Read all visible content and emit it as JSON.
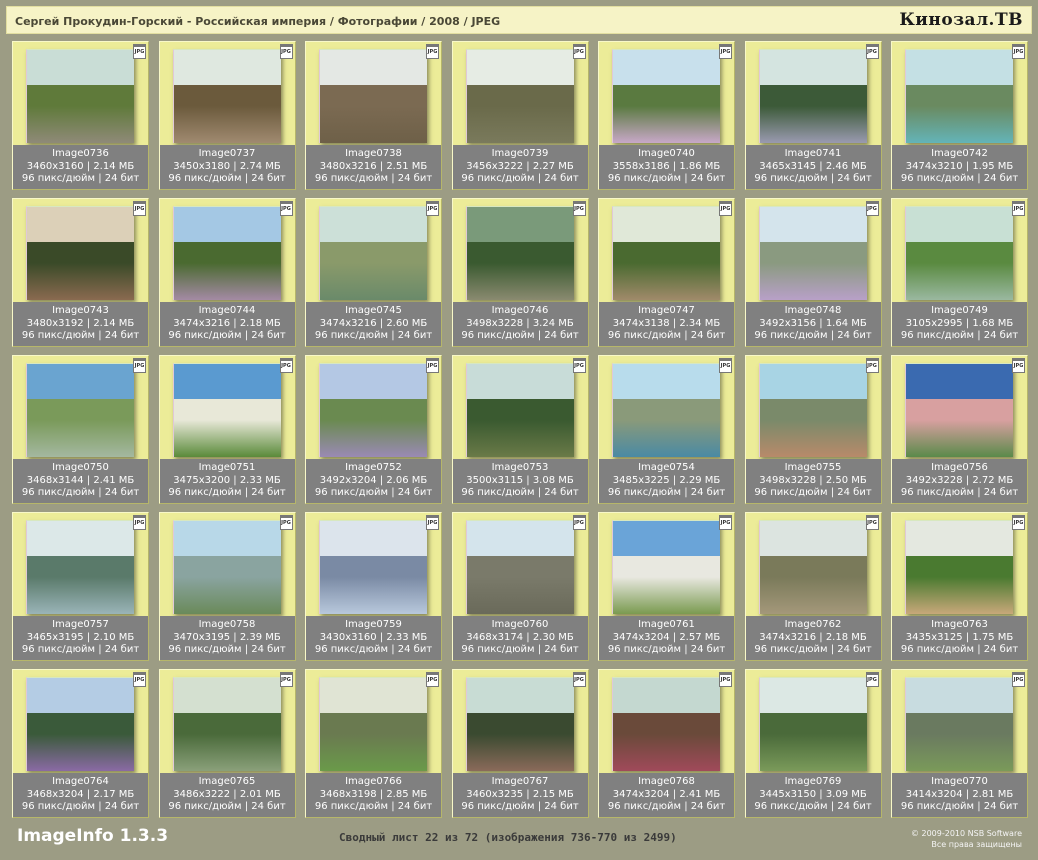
{
  "header": {
    "path": "Сергей Прокудин-Горский - Российская империя / Фотографии / 2008 / JPEG",
    "logo": "Кинозал.ТВ"
  },
  "badge": "JPG",
  "colors": {
    "background": "#9c9c84",
    "card": "#ecec98",
    "info_bar": "#808080",
    "header": "#f6f3c6"
  },
  "images": [
    {
      "name": "Image0736",
      "dims": "3460x3160",
      "size": "2.14 МБ",
      "meta": "96 пикс/дюйм | 24 бит",
      "pal": [
        "#c9ddd6",
        "#5f7a3a",
        "#8f8a78"
      ]
    },
    {
      "name": "Image0737",
      "dims": "3450x3180",
      "size": "2.74 МБ",
      "meta": "96 пикс/дюйм | 24 бит",
      "pal": [
        "#dfe8e0",
        "#6b5a3c",
        "#a08a70"
      ]
    },
    {
      "name": "Image0738",
      "dims": "3480x3216",
      "size": "2.51 МБ",
      "meta": "96 пикс/дюйм | 24 бит",
      "pal": [
        "#e4e8e4",
        "#7b6a52",
        "#6e6048"
      ]
    },
    {
      "name": "Image0739",
      "dims": "3456x3222",
      "size": "2.27 МБ",
      "meta": "96 пикс/дюйм | 24 бит",
      "pal": [
        "#e6ece4",
        "#6a6a4a",
        "#7a7a5c"
      ]
    },
    {
      "name": "Image0740",
      "dims": "3558x3186",
      "size": "1.86 МБ",
      "meta": "96 пикс/дюйм | 24 бит",
      "pal": [
        "#c8e0ec",
        "#5a7a40",
        "#c8a8c8"
      ]
    },
    {
      "name": "Image0741",
      "dims": "3465x3145",
      "size": "2.46 МБ",
      "meta": "96 пикс/дюйм | 24 бит",
      "pal": [
        "#d4e4e0",
        "#3c5a38",
        "#9a9ab0"
      ]
    },
    {
      "name": "Image0742",
      "dims": "3474x3210",
      "size": "1.95 МБ",
      "meta": "96 пикс/дюйм | 24 бит",
      "pal": [
        "#c4e0e4",
        "#6a8a60",
        "#64b4b8"
      ]
    },
    {
      "name": "Image0743",
      "dims": "3480x3192",
      "size": "2.14 МБ",
      "meta": "96 пикс/дюйм | 24 бит",
      "pal": [
        "#dcd0b8",
        "#3a4a28",
        "#8a6a50"
      ]
    },
    {
      "name": "Image0744",
      "dims": "3474x3216",
      "size": "2.18 МБ",
      "meta": "96 пикс/дюйм | 24 бит",
      "pal": [
        "#a4c8e4",
        "#4a6a30",
        "#a48aa4"
      ]
    },
    {
      "name": "Image0745",
      "dims": "3474x3216",
      "size": "2.60 МБ",
      "meta": "96 пикс/дюйм | 24 бит",
      "pal": [
        "#cce0d8",
        "#8a9a6a",
        "#6a8a6a"
      ]
    },
    {
      "name": "Image0746",
      "dims": "3498x3228",
      "size": "3.24 МБ",
      "meta": "96 пикс/дюйм | 24 бит",
      "pal": [
        "#7a9a7a",
        "#3a5a30",
        "#8a8a70"
      ]
    },
    {
      "name": "Image0747",
      "dims": "3474x3138",
      "size": "2.34 МБ",
      "meta": "96 пикс/дюйм | 24 бит",
      "pal": [
        "#e0e8d8",
        "#4a6a30",
        "#a08a6a"
      ]
    },
    {
      "name": "Image0748",
      "dims": "3492x3156",
      "size": "1.64 МБ",
      "meta": "96 пикс/дюйм | 24 бит",
      "pal": [
        "#d4e4ec",
        "#8a9a80",
        "#b8a0c8"
      ]
    },
    {
      "name": "Image0749",
      "dims": "3105x2995",
      "size": "1.68 МБ",
      "meta": "96 пикс/дюйм | 24 бит",
      "pal": [
        "#c8e0d4",
        "#5a8a40",
        "#9ab8a0"
      ]
    },
    {
      "name": "Image0750",
      "dims": "3468x3144",
      "size": "2.41 МБ",
      "meta": "96 пикс/дюйм | 24 бит",
      "pal": [
        "#6aa4d0",
        "#7a9a5a",
        "#a4b8a0"
      ]
    },
    {
      "name": "Image0751",
      "dims": "3475x3200",
      "size": "2.33 МБ",
      "meta": "96 пикс/дюйм | 24 бит",
      "pal": [
        "#5a9ad0",
        "#e8e8d8",
        "#5a8a3a"
      ]
    },
    {
      "name": "Image0752",
      "dims": "3492x3204",
      "size": "2.06 МБ",
      "meta": "96 пикс/дюйм | 24 бит",
      "pal": [
        "#b4c8e4",
        "#6a8a50",
        "#9a8ab4"
      ]
    },
    {
      "name": "Image0753",
      "dims": "3500x3115",
      "size": "3.08 МБ",
      "meta": "96 пикс/дюйм | 24 бит",
      "pal": [
        "#c8dcd8",
        "#3a5a30",
        "#6a7a48"
      ]
    },
    {
      "name": "Image0754",
      "dims": "3485x3225",
      "size": "2.29 МБ",
      "meta": "96 пикс/дюйм | 24 бит",
      "pal": [
        "#b8dcec",
        "#8a9a7a",
        "#4a8aa4"
      ]
    },
    {
      "name": "Image0755",
      "dims": "3498x3228",
      "size": "2.50 МБ",
      "meta": "96 пикс/дюйм | 24 бит",
      "pal": [
        "#a8d4e4",
        "#7a8a6a",
        "#b88a6a"
      ]
    },
    {
      "name": "Image0756",
      "dims": "3492x3228",
      "size": "2.72 МБ",
      "meta": "96 пикс/дюйм | 24 бит",
      "pal": [
        "#3a6ab0",
        "#d8a0a0",
        "#5a8a4a"
      ]
    },
    {
      "name": "Image0757",
      "dims": "3465x3195",
      "size": "2.10 МБ",
      "meta": "96 пикс/дюйм | 24 бит",
      "pal": [
        "#dce8e8",
        "#5a7a6a",
        "#9ab4b8"
      ]
    },
    {
      "name": "Image0758",
      "dims": "3470x3195",
      "size": "2.39 МБ",
      "meta": "96 пикс/дюйм | 24 бит",
      "pal": [
        "#b8d8e8",
        "#8aa4a0",
        "#6a8a5a"
      ]
    },
    {
      "name": "Image0759",
      "dims": "3430x3160",
      "size": "2.33 МБ",
      "meta": "96 пикс/дюйм | 24 бит",
      "pal": [
        "#dce4ec",
        "#7a8aa4",
        "#b8c8dc"
      ]
    },
    {
      "name": "Image0760",
      "dims": "3468x3174",
      "size": "2.30 МБ",
      "meta": "96 пикс/дюйм | 24 бит",
      "pal": [
        "#d4e4ec",
        "#7a7a6a",
        "#6a6a5a"
      ]
    },
    {
      "name": "Image0761",
      "dims": "3474x3204",
      "size": "2.57 МБ",
      "meta": "96 пикс/дюйм | 24 бит",
      "pal": [
        "#6aa4d8",
        "#e8e8e0",
        "#7a9a50"
      ]
    },
    {
      "name": "Image0762",
      "dims": "3474x3216",
      "size": "2.18 МБ",
      "meta": "96 пикс/дюйм | 24 бит",
      "pal": [
        "#dce4e0",
        "#7a7a5a",
        "#a4987a"
      ]
    },
    {
      "name": "Image0763",
      "dims": "3435x3125",
      "size": "1.75 МБ",
      "meta": "96 пикс/дюйм | 24 бит",
      "pal": [
        "#e4e8e0",
        "#4a7a30",
        "#c8a87a"
      ]
    },
    {
      "name": "Image0764",
      "dims": "3468x3204",
      "size": "2.17 МБ",
      "meta": "96 пикс/дюйм | 24 бит",
      "pal": [
        "#b4cce4",
        "#3a5a3a",
        "#8a6aa4"
      ]
    },
    {
      "name": "Image0765",
      "dims": "3486x3222",
      "size": "2.01 МБ",
      "meta": "96 пикс/дюйм | 24 бит",
      "pal": [
        "#d4e0d0",
        "#4a6a3a",
        "#8aa07a"
      ]
    },
    {
      "name": "Image0766",
      "dims": "3468x3198",
      "size": "2.85 МБ",
      "meta": "96 пикс/дюйм | 24 бит",
      "pal": [
        "#e0e4d4",
        "#6a7a50",
        "#6a9a4a"
      ]
    },
    {
      "name": "Image0767",
      "dims": "3460x3235",
      "size": "2.15 МБ",
      "meta": "96 пикс/дюйм | 24 бит",
      "pal": [
        "#c8dcd4",
        "#3a4a30",
        "#8a6a5a"
      ]
    },
    {
      "name": "Image0768",
      "dims": "3474x3204",
      "size": "2.41 МБ",
      "meta": "96 пикс/дюйм | 24 бит",
      "pal": [
        "#c4d8d0",
        "#6a4a3a",
        "#a04a5a"
      ]
    },
    {
      "name": "Image0769",
      "dims": "3445x3150",
      "size": "3.09 МБ",
      "meta": "96 пикс/дюйм | 24 бит",
      "pal": [
        "#dce8e4",
        "#4a6a3a",
        "#7a9a5a"
      ]
    },
    {
      "name": "Image0770",
      "dims": "3414x3204",
      "size": "2.81 МБ",
      "meta": "96 пикс/дюйм | 24 бит",
      "pal": [
        "#c8dce0",
        "#6a7a60",
        "#7a9a5a"
      ]
    }
  ],
  "footer": {
    "app": "ImageInfo 1.3.3",
    "sheet": "Сводный лист 22 из 72 (изображения 736-770 из 2499)",
    "copyright": "© 2009-2010 NSB Software",
    "rights": "Все права защищены"
  }
}
